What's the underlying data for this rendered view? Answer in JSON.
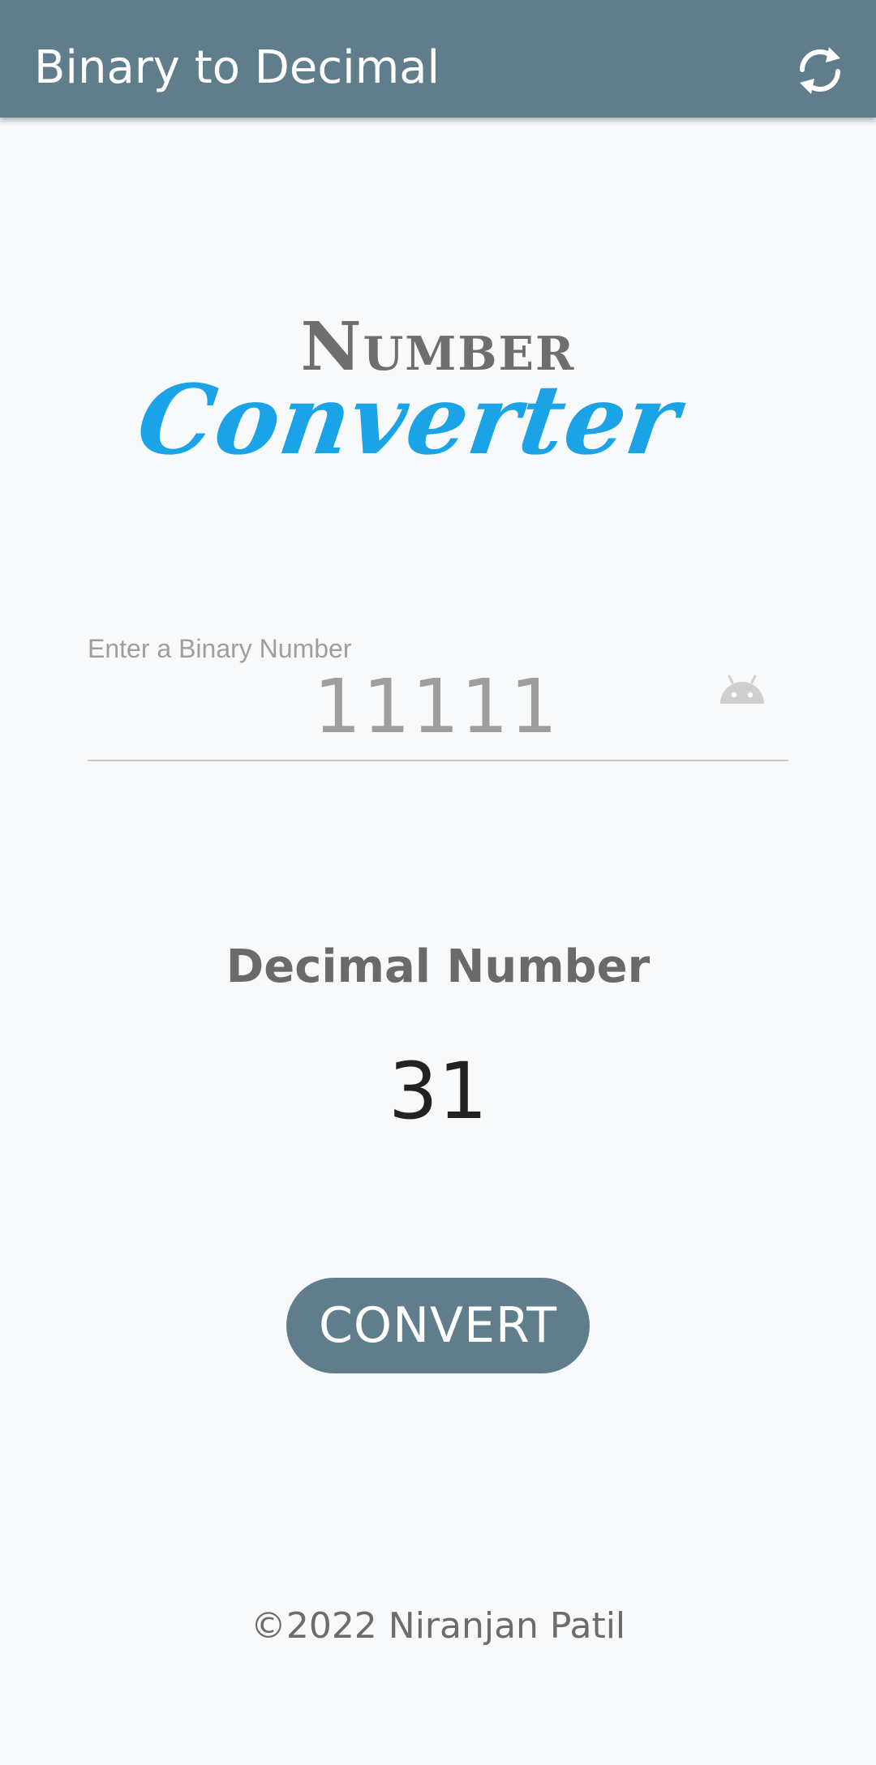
{
  "app": {
    "title": "Binary to Decimal"
  },
  "toolbar": {
    "refresh_icon": "refresh-icon"
  },
  "logo": {
    "line1": "Number",
    "line2": "Converter",
    "line1_color": "#6e6e6e",
    "line2_color": "#1aa3e6"
  },
  "input": {
    "label": "Enter a Binary Number",
    "value": "11111",
    "trailing_icon": "android-icon"
  },
  "result": {
    "title": "Decimal Number",
    "value": "31"
  },
  "actions": {
    "convert_label": "CONVERT"
  },
  "footer": {
    "text": "©2022 Niranjan Patil"
  },
  "colors": {
    "primary": "#607d8b",
    "background": "#f8f9fa",
    "accent": "#1aa3e6"
  }
}
